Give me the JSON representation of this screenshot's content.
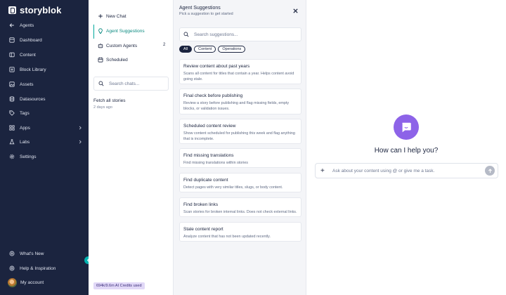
{
  "brand": {
    "name": "storyblok"
  },
  "sidebar": {
    "items": [
      {
        "label": "Agents",
        "icon": "arrow-left-icon"
      },
      {
        "label": "Dashboard",
        "icon": "dashboard-icon"
      },
      {
        "label": "Content",
        "icon": "content-icon"
      },
      {
        "label": "Block Library",
        "icon": "block-library-icon"
      },
      {
        "label": "Assets",
        "icon": "assets-icon"
      },
      {
        "label": "Datasources",
        "icon": "database-icon"
      },
      {
        "label": "Tags",
        "icon": "tag-icon"
      },
      {
        "label": "Apps",
        "icon": "apps-icon"
      },
      {
        "label": "Labs",
        "icon": "labs-icon"
      },
      {
        "label": "Settings",
        "icon": "gear-icon"
      }
    ],
    "bottom": [
      {
        "label": "What's New",
        "icon": "whats-new-icon"
      },
      {
        "label": "Help & Inspiration",
        "icon": "help-icon"
      },
      {
        "label": "My account",
        "icon": "avatar"
      }
    ]
  },
  "chatpanel": {
    "new_chat": "New Chat",
    "agent_suggestions": "Agent Suggestions",
    "custom_agents": "Custom Agents",
    "custom_agents_count": "2",
    "scheduled": "Scheduled",
    "search_placeholder": "Search chats...",
    "history": [
      {
        "title": "Fetch all stories",
        "time": "2 days ago"
      }
    ],
    "credits": "694k/9.6m AI Credits used"
  },
  "suggestions": {
    "title": "Agent Suggestions",
    "subtitle": "Pick a suggestion to get started",
    "search_placeholder": "Search suggestions...",
    "filters": [
      "All",
      "Content",
      "Operations"
    ],
    "active_filter": "All",
    "cards": [
      {
        "title": "Review content about past years",
        "desc": "Scans all content for titles that contain a year. Helps content avoid going stale."
      },
      {
        "title": "Final check before publishing",
        "desc": "Review a story before publishing and flag missing fields, empty blocks, or validation issues."
      },
      {
        "title": "Scheduled content review",
        "desc": "Show content scheduled for publishing this week and flag anything that is incomplete."
      },
      {
        "title": "Find missing translations",
        "desc": "Find missing translations within stories"
      },
      {
        "title": "Find duplicate content",
        "desc": "Detect pages with very similar titles, slugs, or body content."
      },
      {
        "title": "Find broken links",
        "desc": "Scan stories for broken internal links. Does not check external links."
      },
      {
        "title": "Stale content report",
        "desc": "Analyze content that has not been updated recently."
      }
    ]
  },
  "main": {
    "heading": "How can I help you?",
    "input_placeholder": "Ask about your content using @ or give me a task."
  },
  "colors": {
    "sidebar_bg": "#1b243f",
    "accent_teal": "#00a99d",
    "bot_purple": "#8d63e8"
  }
}
